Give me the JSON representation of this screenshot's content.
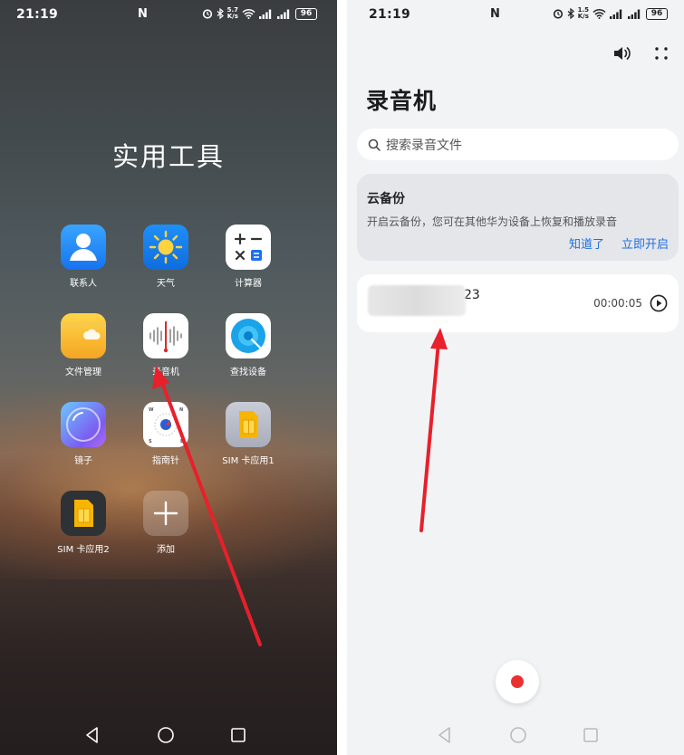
{
  "left": {
    "status": {
      "time": "21:19",
      "nfc": "N",
      "net_top": "5.7",
      "net_bottom": "K/s",
      "battery": "96"
    },
    "folder_title": "实用工具",
    "apps": [
      {
        "name": "联系人"
      },
      {
        "name": "天气"
      },
      {
        "name": "计算器"
      },
      {
        "name": "文件管理"
      },
      {
        "name": "录音机"
      },
      {
        "name": "查找设备"
      },
      {
        "name": "镜子"
      },
      {
        "name": "指南针"
      },
      {
        "name": "SIM 卡应用1"
      },
      {
        "name": "SIM 卡应用2"
      },
      {
        "name": "添加"
      }
    ]
  },
  "right": {
    "status": {
      "time": "21:19",
      "nfc": "N",
      "net_top": "1.5",
      "net_bottom": "K/s",
      "battery": "96"
    },
    "title": "录音机",
    "search_placeholder": "搜索录音文件",
    "backup": {
      "title": "云备份",
      "desc": "开启云备份，您可在其他华为设备上恢复和播放录音",
      "btn_dismiss": "知道了",
      "btn_enable": "立即开启"
    },
    "recording": {
      "name_suffix": "23",
      "duration": "00:00:05"
    }
  },
  "colors": {
    "accent": "#1f6fe0",
    "record": "#e9322f",
    "annotation": "#e8202b"
  }
}
